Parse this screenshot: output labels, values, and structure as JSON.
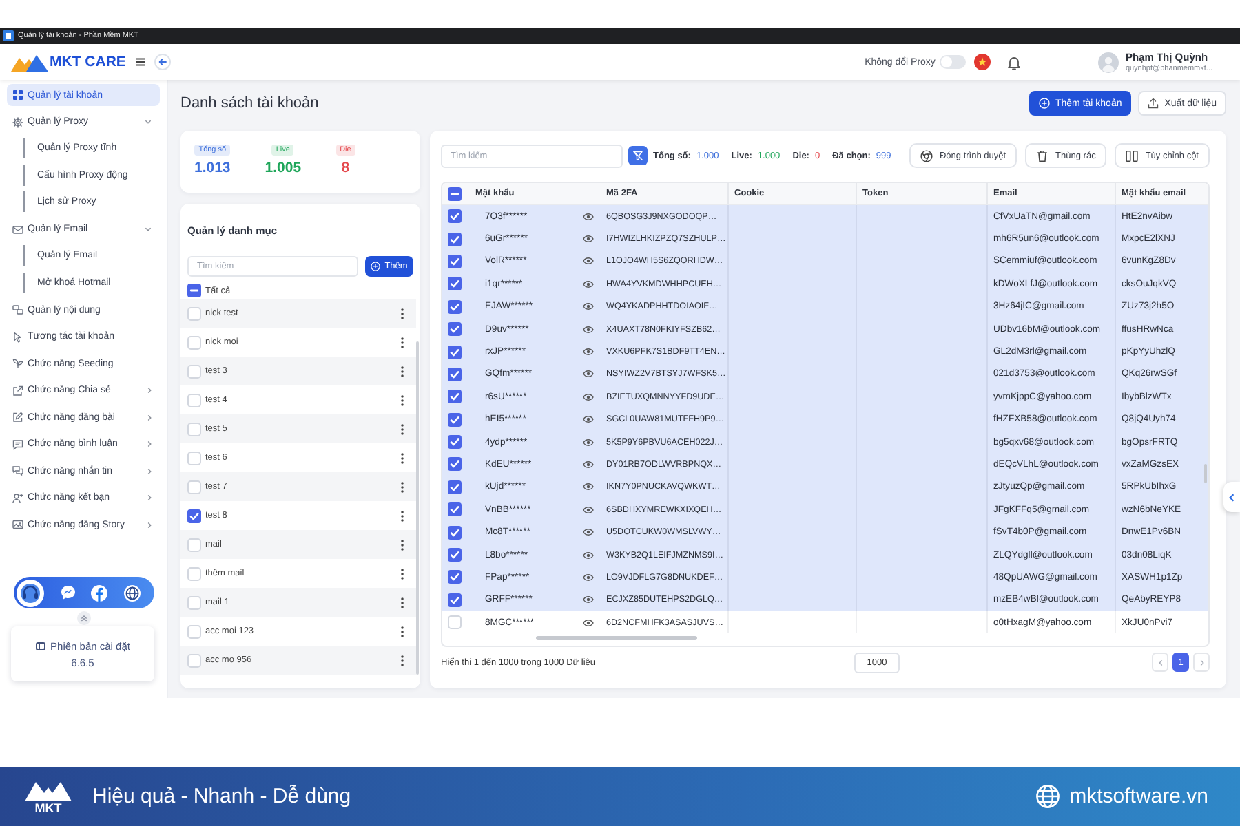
{
  "window": {
    "title": "Quản lý tài khoản - Phần Mềm MKT"
  },
  "header": {
    "logo": "MKT CARE",
    "proxy_toggle": {
      "label": "Không đổi Proxy",
      "on": false
    },
    "user": {
      "name": "Phạm Thị Quỳnh",
      "email": "quynhpt@phanmemmkt..."
    }
  },
  "sidebar": {
    "items": [
      {
        "label": "Quản lý tài khoản",
        "selected": true
      },
      {
        "label": "Quản lý Proxy",
        "selected": false,
        "expanded": true,
        "children": [
          {
            "label": "Quản lý Proxy tĩnh",
            "selected": false
          },
          {
            "label": "Cấu hình Proxy động",
            "selected": false
          },
          {
            "label": "Lịch sử Proxy",
            "selected": false
          }
        ]
      },
      {
        "label": "Quản lý Email",
        "selected": false,
        "expanded": true,
        "children": [
          {
            "label": "Quản lý Email",
            "selected": false
          },
          {
            "label": "Mở khoá Hotmail",
            "selected": false
          }
        ]
      },
      {
        "label": "Quản lý nội dung",
        "selected": false
      },
      {
        "label": "Tương tác tài khoản",
        "selected": false
      },
      {
        "label": "Chức năng Seeding",
        "selected": false
      },
      {
        "label": "Chức năng Chia sẻ",
        "selected": false,
        "expanded": false
      },
      {
        "label": "Chức năng đăng bài",
        "selected": false,
        "expanded": false
      },
      {
        "label": "Chức năng bình luận",
        "selected": false,
        "expanded": false
      },
      {
        "label": "Chức năng nhắn tin",
        "selected": false,
        "expanded": false
      },
      {
        "label": "Chức năng kết bạn",
        "selected": false,
        "expanded": false
      },
      {
        "label": "Chức năng đăng Story",
        "selected": false,
        "expanded": false
      }
    ],
    "version": {
      "label": "Phiên bản cài đặt",
      "number": "6.6.5"
    }
  },
  "page": {
    "title": "Danh sách tài khoản",
    "actions": [
      {
        "label": "Thêm tài khoản",
        "kind": "primary"
      },
      {
        "label": "Xuất dữ liệu",
        "kind": "secondary"
      }
    ]
  },
  "stats": [
    {
      "label": "Tổng số",
      "value": "1.013",
      "color": "#3d6fdb"
    },
    {
      "label": "Live",
      "value": "1.005",
      "color": "#1fa65a"
    },
    {
      "label": "Die",
      "value": "8",
      "color": "#e5484d"
    }
  ],
  "categories": {
    "title": "Quản lý danh mục",
    "search": {
      "placeholder": "Tìm kiếm"
    },
    "add_button": "Thêm",
    "all": {
      "label": "Tất cả",
      "checked": false,
      "indeterminate": true
    },
    "items": [
      {
        "label": "nick test",
        "checked": false
      },
      {
        "label": "nick moi",
        "checked": false
      },
      {
        "label": "test 3",
        "checked": false
      },
      {
        "label": "test 4",
        "checked": false
      },
      {
        "label": "test 5",
        "checked": false
      },
      {
        "label": "test 6",
        "checked": false
      },
      {
        "label": "test 7",
        "checked": false
      },
      {
        "label": "test 8",
        "checked": true
      },
      {
        "label": "mail",
        "checked": false
      },
      {
        "label": "thêm mail",
        "checked": false
      },
      {
        "label": "mail 1",
        "checked": false
      },
      {
        "label": "acc moi 123",
        "checked": false
      },
      {
        "label": "acc mo 956",
        "checked": false
      }
    ]
  },
  "table": {
    "search": {
      "placeholder": "Tìm kiếm"
    },
    "summary": [
      {
        "label": "Tổng số:",
        "value": "1.000",
        "color": "#3d6fdb"
      },
      {
        "label": "Live:",
        "value": "1.000",
        "color": "#1fa65a"
      },
      {
        "label": "Die:",
        "value": "0",
        "color": "#e5484d"
      },
      {
        "label": "Đã chọn:",
        "value": "999",
        "color": "#3d6fdb"
      }
    ],
    "tools": [
      "Đóng trình duyệt",
      "Thùng rác",
      "Tùy chỉnh cột"
    ],
    "header_checkbox": {
      "checked": false,
      "indeterminate": true
    },
    "columns": [
      "Mật khẩu",
      "Mã 2FA",
      "Cookie",
      "Token",
      "Email",
      "Mật khẩu email"
    ],
    "rows": [
      {
        "selected": true,
        "password": "7O3f******",
        "code_2fa": "6QBOSG3J9NXGODOQP…",
        "email": "CfVxUaTN@gmail.com",
        "email_password": "HtE2nvAibw"
      },
      {
        "selected": true,
        "password": "6uGr******",
        "code_2fa": "I7HWIZLHKIZPZQ7SZHULP…",
        "email": "mh6R5un6@outlook.com",
        "email_password": "MxpcE2lXNJ"
      },
      {
        "selected": true,
        "password": "VolR******",
        "code_2fa": "L1OJO4WH5S6ZQORHDW…",
        "email": "SCemmiuf@outlook.com",
        "email_password": "6vunKgZ8Dv"
      },
      {
        "selected": true,
        "password": "i1qr******",
        "code_2fa": "HWA4YVKMDWHHPCUEH…",
        "email": "kDWoXLfJ@outlook.com",
        "email_password": "cksOuJqkVQ"
      },
      {
        "selected": true,
        "password": "EJAW******",
        "code_2fa": "WQ4YKADPHHTDOIAOIF…",
        "email": "3Hz64jIC@gmail.com",
        "email_password": "ZUz73j2h5O"
      },
      {
        "selected": true,
        "password": "D9uv******",
        "code_2fa": "X4UAXT78N0FKIYFSZB62…",
        "email": "UDbv16bM@outlook.com",
        "email_password": "ffusHRwNca"
      },
      {
        "selected": true,
        "password": "rxJP******",
        "code_2fa": "VXKU6PFK7S1BDF9TT4EN…",
        "email": "GL2dM3rl@gmail.com",
        "email_password": "pKpYyUhzlQ"
      },
      {
        "selected": true,
        "password": "GQfm******",
        "code_2fa": "NSYIWZ2V7BTSYJ7WFSK5…",
        "email": "021d3753@outlook.com",
        "email_password": "QKq26rwSGf"
      },
      {
        "selected": true,
        "password": "r6sU******",
        "code_2fa": "BZIETUXQMNNYYFD9UDE…",
        "email": "yvmKjppC@yahoo.com",
        "email_password": "IbybBlzWTx"
      },
      {
        "selected": true,
        "password": "hEI5******",
        "code_2fa": "SGCL0UAW81MUTFFH9P9…",
        "email": "fHZFXB58@outlook.com",
        "email_password": "Q8jQ4Uyh74"
      },
      {
        "selected": true,
        "password": "4ydp******",
        "code_2fa": "5K5P9Y6PBVU6ACEH022J…",
        "email": "bg5qxv68@outlook.com",
        "email_password": "bgOpsrFRTQ"
      },
      {
        "selected": true,
        "password": "KdEU******",
        "code_2fa": "DY01RB7ODLWVRBPNQX…",
        "email": "dEQcVLhL@outlook.com",
        "email_password": "vxZaMGzsEX"
      },
      {
        "selected": true,
        "password": "kUjd******",
        "code_2fa": "IKN7Y0PNUCKAVQWKWT…",
        "email": "zJtyuzQp@gmail.com",
        "email_password": "5RPkUbIhxG"
      },
      {
        "selected": true,
        "password": "VnBB******",
        "code_2fa": "6SBDHXYMREWKXIXQEH…",
        "email": "JFgKFFq5@gmail.com",
        "email_password": "wzN6bNeYKE"
      },
      {
        "selected": true,
        "password": "Mc8T******",
        "code_2fa": "U5DOTCUKW0WMSLVWY…",
        "email": "fSvT4b0P@gmail.com",
        "email_password": "DnwE1Pv6BN"
      },
      {
        "selected": true,
        "password": "L8bo******",
        "code_2fa": "W3KYB2Q1LEIFJMZNMS9I…",
        "email": "ZLQYdgll@outlook.com",
        "email_password": "03dn08LiqK"
      },
      {
        "selected": true,
        "password": "FPap******",
        "code_2fa": "LO9VJDFLG7G8DNUKDEF…",
        "email": "48QpUAWG@gmail.com",
        "email_password": "XASWH1p1Zp"
      },
      {
        "selected": true,
        "password": "GRFF******",
        "code_2fa": "ECJXZ85DUTEHPS2DGLQ…",
        "email": "mzEB4wBl@outlook.com",
        "email_password": "QeAbyREYP8"
      },
      {
        "selected": false,
        "password": "8MGC******",
        "code_2fa": "6D2NCFMHFK3ASASJUVS…",
        "email": "o0tHxagM@yahoo.com",
        "email_password": "XkJU0nPvi7"
      }
    ],
    "footer": {
      "summary": "Hiển thị 1 đến 1000 trong 1000 Dữ liệu",
      "page_size": "1000",
      "pages": [
        {
          "label": "1",
          "selected": true
        }
      ]
    }
  },
  "banner": {
    "logo": "MKT",
    "tagline": "Hiệu quả - Nhanh - Dễ dùng",
    "website": "mktsoftware.vn"
  }
}
